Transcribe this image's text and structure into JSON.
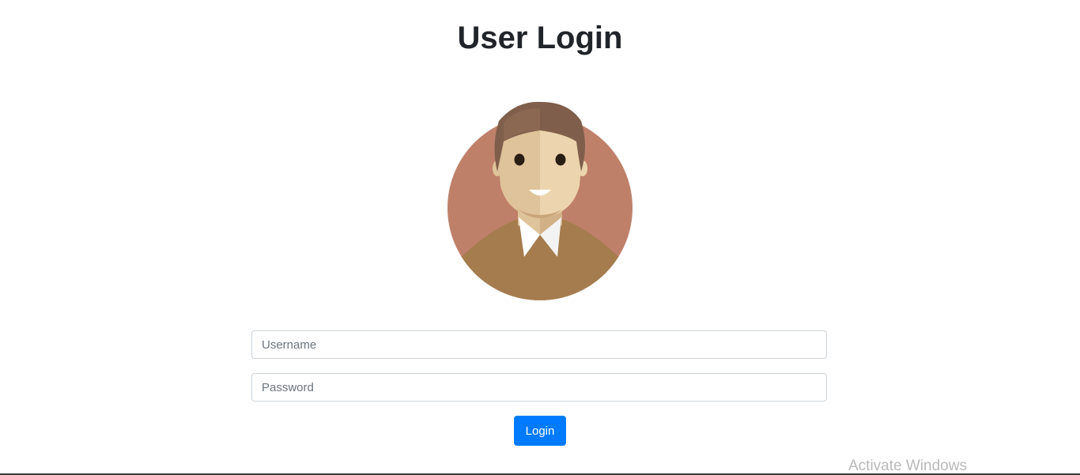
{
  "page": {
    "title": "User Login"
  },
  "avatar": {
    "icon": "user-avatar-icon",
    "colors": {
      "background": "#bf806a",
      "hair": "#7f5f4b",
      "skin_light": "#ecd5ae",
      "skin_shade": "#dfc39a",
      "sweater": "#a57c4d",
      "collar": "#ffffff"
    }
  },
  "form": {
    "username_placeholder": "Username",
    "password_placeholder": "Password",
    "login_label": "Login"
  },
  "colors": {
    "accent": "#007bff"
  },
  "watermark": {
    "text": "Activate Windows"
  }
}
